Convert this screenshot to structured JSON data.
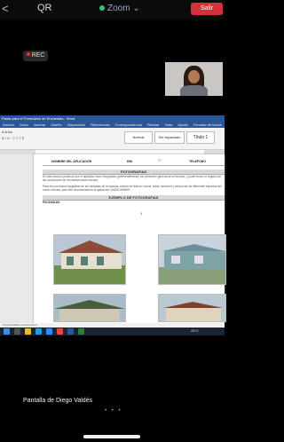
{
  "zoom_bar": {
    "back_glyph": "<",
    "qr_label": "QR",
    "app_label": "Zoom",
    "leave_label": "Salir"
  },
  "recording": {
    "label": "REC"
  },
  "word": {
    "title": "Pauta para el Formulario de Encuestas - Word",
    "menu": [
      "Archivo",
      "Inicio",
      "Insertar",
      "Diseño",
      "Disposición",
      "Referencias",
      "Correspondencia",
      "Revisar",
      "Vista",
      "Ayuda",
      "Formato de forma",
      "Diseño de tabla"
    ],
    "font_row": "A A Aa",
    "styles": [
      "Normal",
      "Sin espaciado",
      "Título 1"
    ],
    "table": {
      "col_headers": [
        "NOMBRE DEL APLICADOR",
        "DNI",
        "TELEFONO"
      ],
      "section_fotos": "FOTOGRAFIAS",
      "fotos_text_1": "En esta sección pedimos que el aplicador tome fotografías (preferentemente) del perímetro general de la escuela, y poder tener un registro de las condiciones de la infraestructura escolar.",
      "fotos_text_2": "Para ello produzca fotografías de las fachadas de la escuela, estado de techos, muros, aulas, servicios y pintura de los diferentes espacios del centro escolar, para ello recomendamos la aplicación CAMSCANNER.",
      "section_ejemplo": "EJEMPLO DE FOTOGRAFIAS",
      "fachadas_label": "FACHADAS",
      "page_number": "1"
    },
    "status_text": "Se ha grabado el documento",
    "taskbar_right": "26°C"
  },
  "footer": {
    "speaker": "Pantalla de Diego Valdés",
    "pager": "• • •"
  },
  "colors": {
    "word_blue": "#2b579a",
    "leave_red": "#d6313b"
  }
}
